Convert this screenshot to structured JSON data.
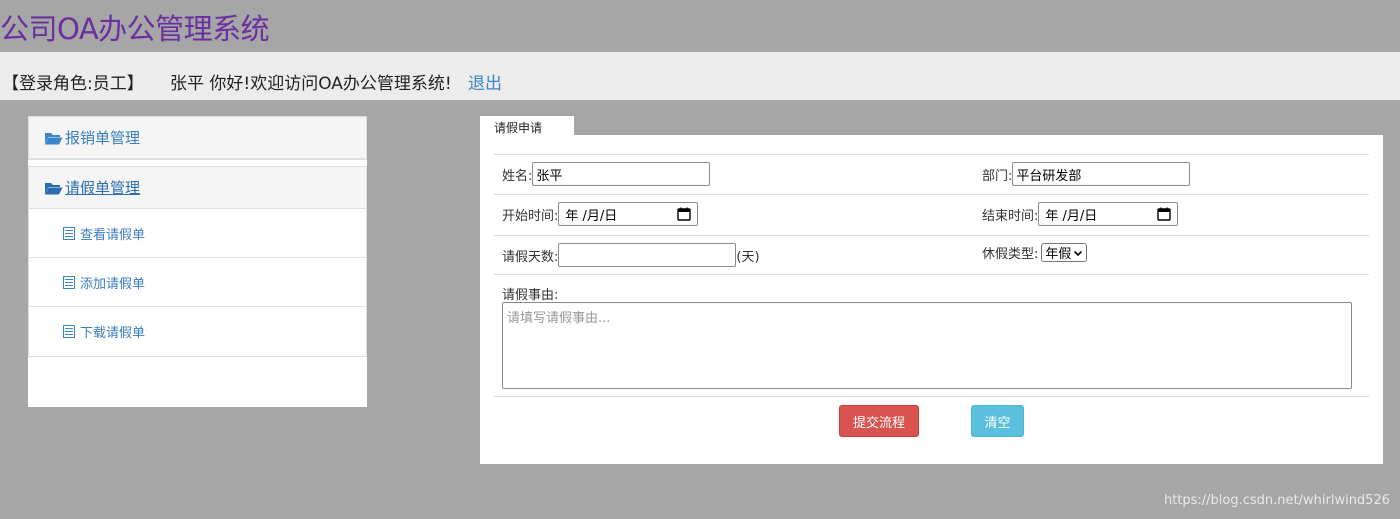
{
  "app": {
    "title": "公司OA办公管理系统"
  },
  "userbar": {
    "role": "【登录角色:员工】",
    "welcome": "张平 你好!欢迎访问OA办公管理系统!",
    "logout": "退出"
  },
  "sidebar": {
    "sections": [
      {
        "label": "报销单管理",
        "icon": "folder-open-icon"
      },
      {
        "label": "请假单管理",
        "icon": "folder-open-icon"
      }
    ],
    "items": [
      {
        "label": "查看请假单",
        "icon": "list-doc-icon"
      },
      {
        "label": "添加请假单",
        "icon": "list-doc-icon"
      },
      {
        "label": "下载请假单",
        "icon": "list-doc-icon"
      }
    ]
  },
  "form": {
    "tab": "请假申请",
    "name_label": "姓名:",
    "name_value": "张平",
    "dept_label": "部门:",
    "dept_value": "平台研发部",
    "start_label": "开始时间:",
    "start_placeholder": "年 /月/日",
    "end_label": "结束时间:",
    "end_placeholder": "年 /月/日",
    "days_label": "请假天数:",
    "days_value": "",
    "days_unit": "(天)",
    "type_label": "休假类型:",
    "type_value": "年假",
    "reason_label": "请假事由:",
    "reason_placeholder": "请填写请假事由...",
    "submit": "提交流程",
    "clear": "清空"
  },
  "colors": {
    "title": "#6a2fa0",
    "link": "#3b86c8",
    "submit": "#d9534f",
    "clear": "#5bc0de"
  },
  "watermark": "https://blog.csdn.net/whirlwind526"
}
